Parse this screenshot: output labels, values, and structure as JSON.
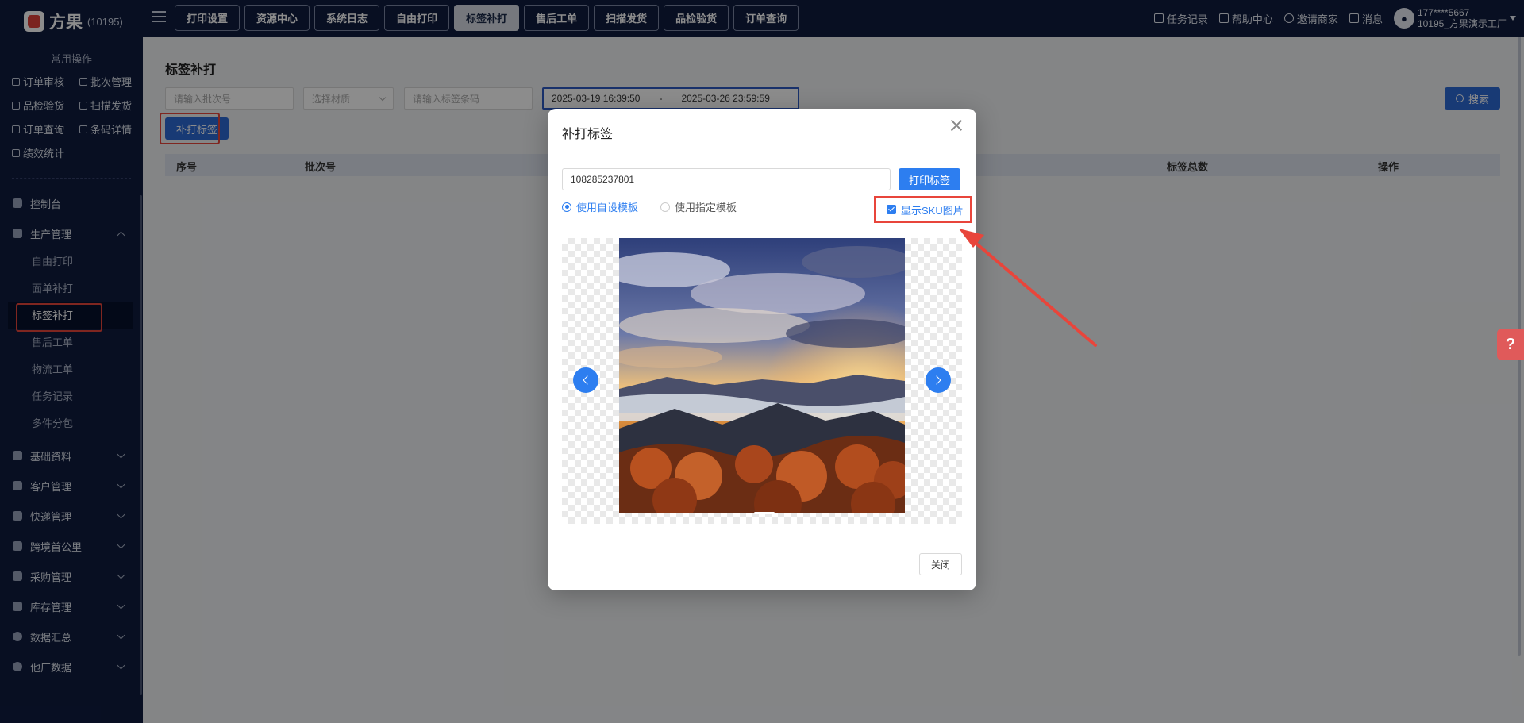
{
  "app": {
    "name": "方果",
    "tenant_code": "(10195)"
  },
  "top_tabs": [
    {
      "label": "打印设置",
      "active": false
    },
    {
      "label": "资源中心",
      "active": false
    },
    {
      "label": "系统日志",
      "active": false
    },
    {
      "label": "自由打印",
      "active": false
    },
    {
      "label": "标签补打",
      "active": true
    },
    {
      "label": "售后工单",
      "active": false
    },
    {
      "label": "扫描发货",
      "active": false
    },
    {
      "label": "品检验货",
      "active": false
    },
    {
      "label": "订单查询",
      "active": false
    }
  ],
  "header_right": {
    "task_record": "任务记录",
    "help_center": "帮助中心",
    "invite_merchant": "邀请商家",
    "messages": "消息",
    "user_phone": "177****5667",
    "user_factory": "10195_方果演示工厂"
  },
  "sidebar": {
    "common_title": "常用操作",
    "common_items": [
      "订单审核",
      "批次管理",
      "品检验货",
      "扫描发货",
      "订单查询",
      "条码详情",
      "绩效统计"
    ],
    "groups": [
      {
        "label": "控制台"
      },
      {
        "label": "生产管理",
        "expanded": true
      },
      {
        "label": "基础资料"
      },
      {
        "label": "客户管理"
      },
      {
        "label": "快递管理"
      },
      {
        "label": "跨境首公里"
      },
      {
        "label": "采购管理"
      },
      {
        "label": "库存管理"
      },
      {
        "label": "数据汇总"
      },
      {
        "label": "他厂数据"
      }
    ],
    "production_items": [
      "自由打印",
      "面单补打",
      "标签补打",
      "售后工单",
      "物流工单",
      "任务记录",
      "多件分包"
    ],
    "active_item": "标签补打"
  },
  "page": {
    "title": "标签补打",
    "filters": {
      "batch_placeholder": "请输入批次号",
      "material_placeholder": "选择材质",
      "barcode_placeholder": "请输入标签条码",
      "date_start": "2025-03-19 16:39:50",
      "date_sep": "-",
      "date_end": "2025-03-26 23:59:59"
    },
    "search_label": "搜索",
    "reprint_label": "补打标签",
    "table_columns": [
      "序号",
      "批次号",
      "标签总数",
      "操作"
    ]
  },
  "modal": {
    "title": "补打标签",
    "barcode_value": "108285237801",
    "print_label": "打印标签",
    "radio_custom": "使用自设模板",
    "radio_specified": "使用指定模板",
    "selected_template": "使用自设模板",
    "show_sku_label": "显示SKU图片",
    "show_sku_checked": true,
    "close_label": "关闭"
  },
  "colors": {
    "nav_bg": "#0f1c3f",
    "primary": "#2d7ef0",
    "highlight": "#e8453b"
  }
}
